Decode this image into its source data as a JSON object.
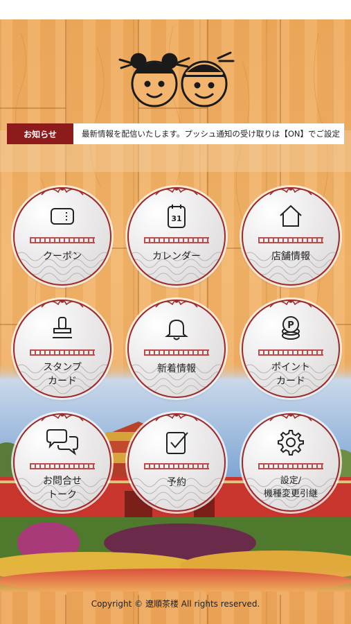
{
  "news": {
    "label": "お知らせ",
    "text": "最新情報を配信いたします。プッシュ通知の受け取りは【ON】でご設定"
  },
  "menu": [
    {
      "label": "クーポン",
      "icon": "coupon-icon"
    },
    {
      "label": "カレンダー",
      "icon": "calendar-icon",
      "calendar_day": "31"
    },
    {
      "label": "店舗情報",
      "icon": "home-icon"
    },
    {
      "label": "スタンプ\nカード",
      "icon": "stamp-icon"
    },
    {
      "label": "新着情報",
      "icon": "bell-icon"
    },
    {
      "label": "ポイント\nカード",
      "icon": "point-coin-icon",
      "coin_letter": "P"
    },
    {
      "label": "お問合せ\nトーク",
      "icon": "chat-bubbles-icon"
    },
    {
      "label": "予約",
      "icon": "reservation-check-icon"
    },
    {
      "label": "設定/\n機種変更引継",
      "icon": "gear-icon"
    }
  ],
  "footer": {
    "copyright": "Copyright © 遼順茶楼 All rights reserved."
  },
  "colors": {
    "accent": "#8e1b1b",
    "wood": "#efaa5c"
  }
}
